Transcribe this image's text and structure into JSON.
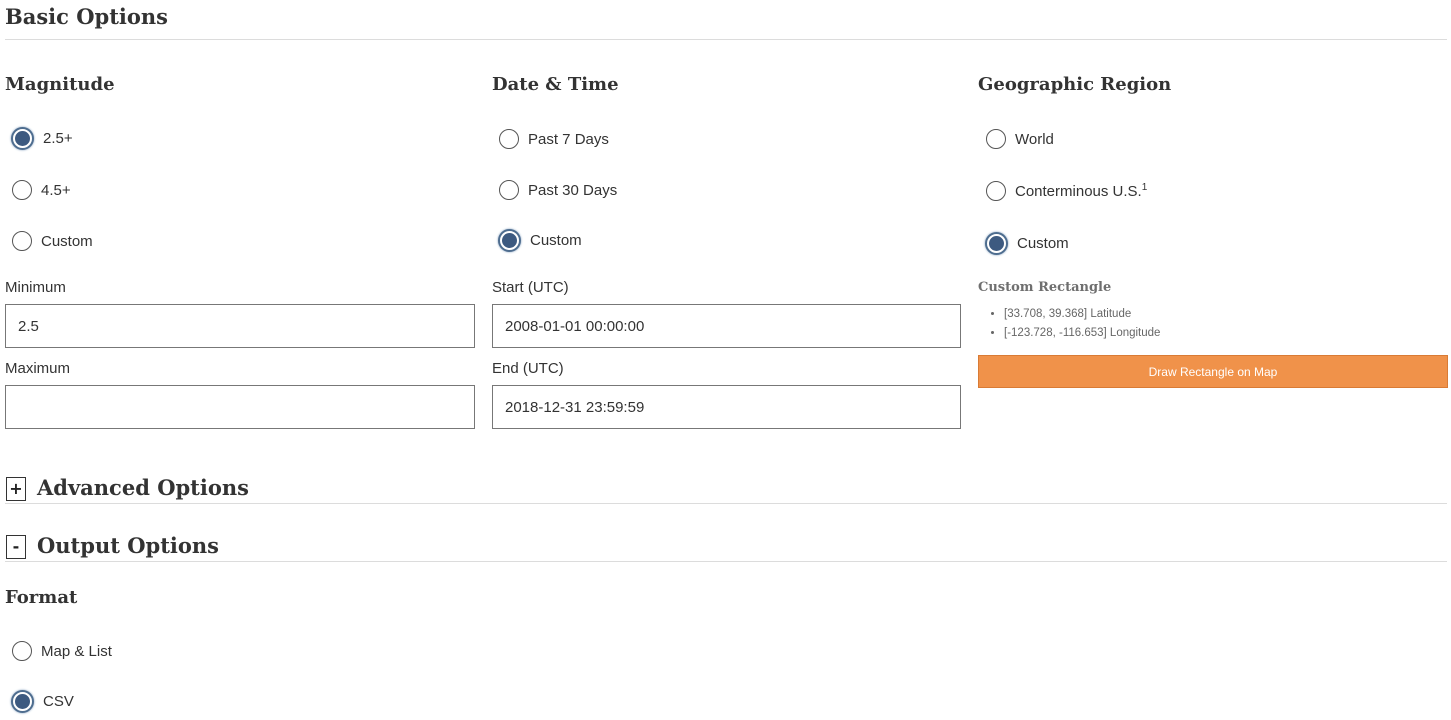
{
  "basic_options": {
    "title": "Basic Options"
  },
  "magnitude": {
    "title": "Magnitude",
    "options": [
      {
        "label": "2.5+",
        "checked": true
      },
      {
        "label": "4.5+",
        "checked": false
      },
      {
        "label": "Custom",
        "checked": false
      }
    ],
    "minimum_label": "Minimum",
    "minimum_value": "2.5",
    "maximum_label": "Maximum",
    "maximum_value": ""
  },
  "date_time": {
    "title": "Date & Time",
    "options": [
      {
        "label": "Past 7 Days",
        "checked": false
      },
      {
        "label": "Past 30 Days",
        "checked": false
      },
      {
        "label": "Custom",
        "checked": true
      }
    ],
    "start_label": "Start (UTC)",
    "start_value": "2008-01-01 00:00:00",
    "end_label": "End (UTC)",
    "end_value": "2018-12-31 23:59:59"
  },
  "region": {
    "title": "Geographic Region",
    "options": [
      {
        "label": "World",
        "checked": false
      },
      {
        "label": "Conterminous U.S.",
        "footnote": "1",
        "checked": false
      },
      {
        "label": "Custom",
        "checked": true
      }
    ],
    "rect_title": "Custom Rectangle",
    "rect_items": [
      "[33.708, 39.368] Latitude",
      "[-123.728, -116.653] Longitude"
    ],
    "draw_button": "Draw Rectangle on Map"
  },
  "advanced_options": {
    "toggle": "+",
    "title": "Advanced Options"
  },
  "output_options": {
    "toggle": "-",
    "title": "Output Options"
  },
  "format": {
    "title": "Format",
    "options": [
      {
        "label": "Map & List",
        "checked": false
      },
      {
        "label": "CSV",
        "checked": true
      }
    ]
  },
  "colors": {
    "accent_button": "#f0924a",
    "radio_checked": "#3d5a80"
  }
}
